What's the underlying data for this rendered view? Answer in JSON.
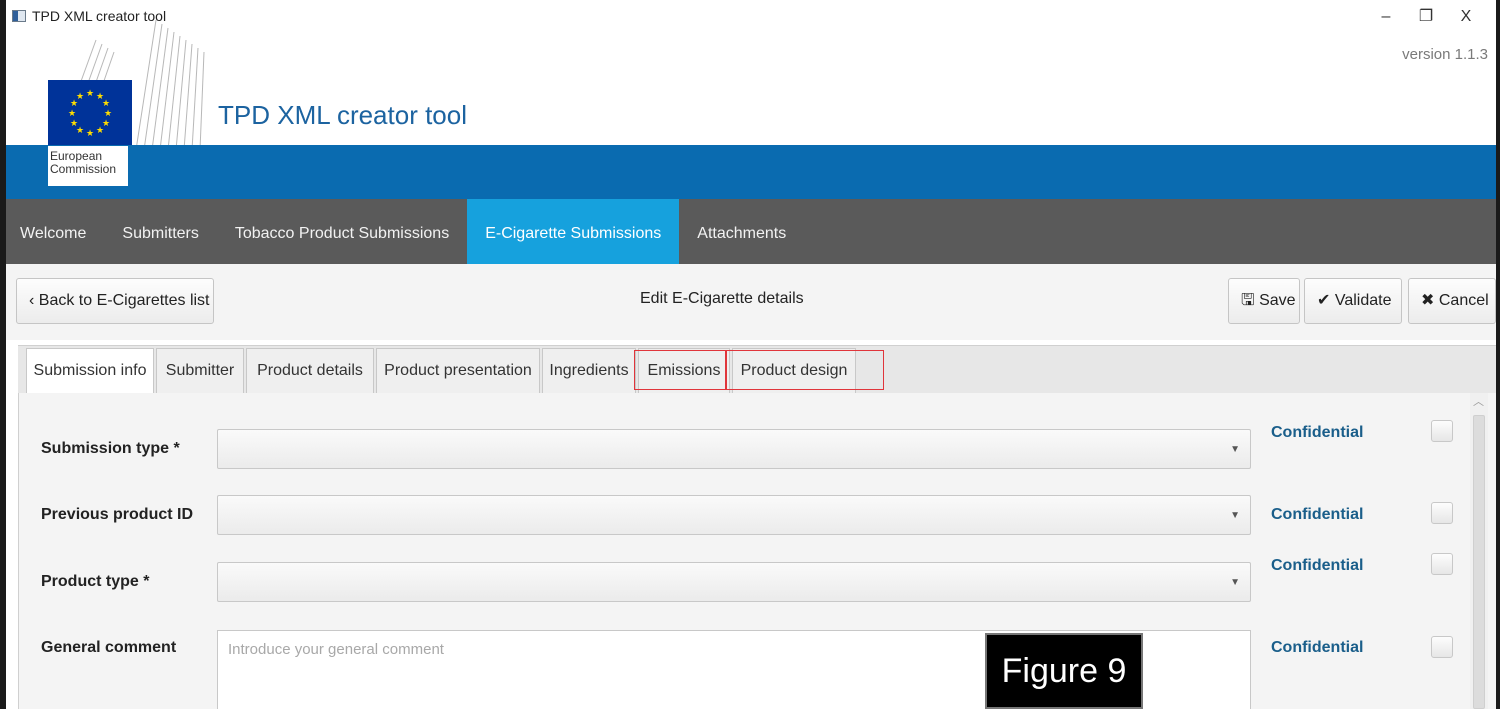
{
  "window": {
    "title": "TPD XML creator tool",
    "controls": [
      "–",
      "❐",
      "X"
    ]
  },
  "header": {
    "version": "version 1.1.3",
    "org_label_line1": "European",
    "org_label_line2": "Commission",
    "app_title": "TPD XML creator tool"
  },
  "nav": {
    "items": [
      {
        "label": "Welcome"
      },
      {
        "label": "Submitters"
      },
      {
        "label": "Tobacco Product Submissions"
      },
      {
        "label": "E-Cigarette Submissions"
      },
      {
        "label": "Attachments"
      }
    ],
    "active": "E-Cigarette Submissions"
  },
  "toolbar": {
    "back_label": "‹ Back to E-Cigarettes list",
    "title": "Edit E-Cigarette details",
    "save_label": "Save",
    "validate_label": "Validate",
    "cancel_label": "Cancel"
  },
  "tabs": [
    {
      "label": "Submission info"
    },
    {
      "label": "Submitter"
    },
    {
      "label": "Product details"
    },
    {
      "label": "Product presentation"
    },
    {
      "label": "Ingredients"
    },
    {
      "label": "Emissions"
    },
    {
      "label": "Product design"
    }
  ],
  "active_tab": "Submission info",
  "highlighted_tabs": [
    "Emissions",
    "Product design"
  ],
  "form": {
    "fields": [
      {
        "label": "Submission type *",
        "confidential": "Confidential"
      },
      {
        "label": "Previous product ID",
        "confidential": "Confidential"
      },
      {
        "label": "Product type *",
        "confidential": "Confidential"
      },
      {
        "label": "General comment",
        "placeholder": "Introduce your general comment",
        "confidential": "Confidential"
      }
    ]
  },
  "figure_label": "Figure 9",
  "colors": {
    "brand_blue": "#0a6bb0",
    "nav_bg": "#5a5a5a",
    "nav_active": "#16a1dd",
    "confidential_text": "#1a5e8a",
    "highlight_box": "#e0353b"
  }
}
